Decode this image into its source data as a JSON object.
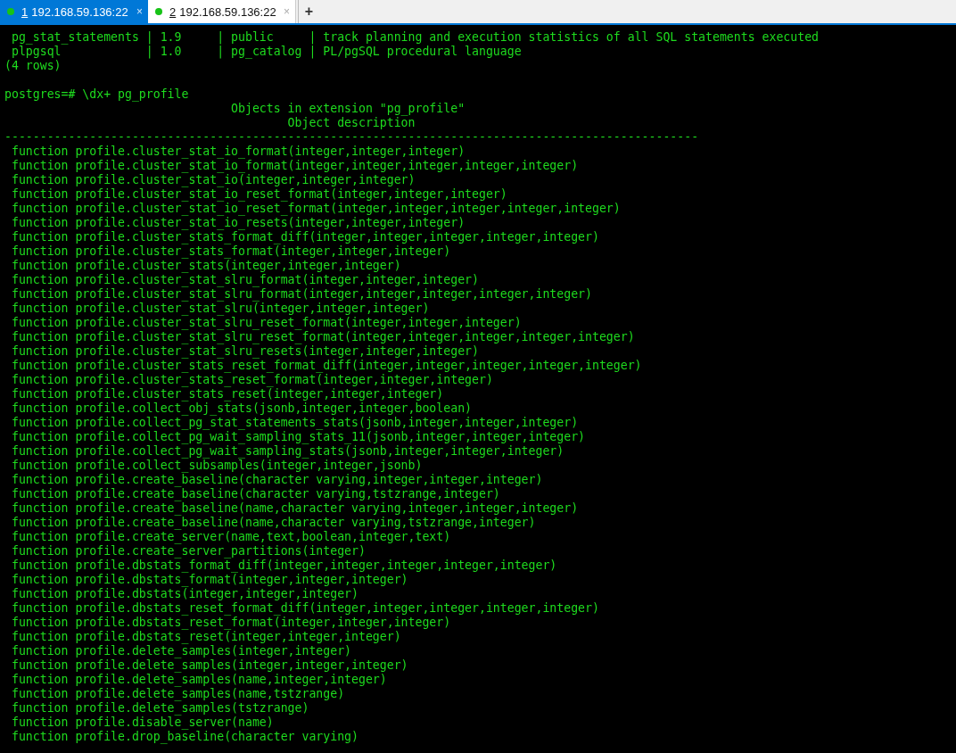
{
  "tabs": [
    {
      "number": "1",
      "address": "192.168.59.136:22",
      "connected": true,
      "selected": true,
      "close": "×"
    },
    {
      "number": "2",
      "address": "192.168.59.136:22",
      "connected": true,
      "selected": false,
      "close": "×"
    }
  ],
  "new_tab": "+",
  "terminal": {
    "blocks": [
      {
        "lines": [
          " pg_stat_statements | 1.9     | public     | track planning and execution statistics of all SQL statements executed",
          " plpgsql            | 1.0     | pg_catalog | PL/pgSQL procedural language",
          "(4 rows)"
        ]
      },
      {
        "lines": [
          "postgres=# \\dx+ pg_profile",
          "                                Objects in extension \"pg_profile\"",
          "                                        Object description",
          "--------------------------------------------------------------------------------------------------",
          " function profile.cluster_stat_io_format(integer,integer,integer)",
          " function profile.cluster_stat_io_format(integer,integer,integer,integer,integer)",
          " function profile.cluster_stat_io(integer,integer,integer)",
          " function profile.cluster_stat_io_reset_format(integer,integer,integer)",
          " function profile.cluster_stat_io_reset_format(integer,integer,integer,integer,integer)",
          " function profile.cluster_stat_io_resets(integer,integer,integer)",
          " function profile.cluster_stats_format_diff(integer,integer,integer,integer,integer)",
          " function profile.cluster_stats_format(integer,integer,integer)",
          " function profile.cluster_stats(integer,integer,integer)",
          " function profile.cluster_stat_slru_format(integer,integer,integer)",
          " function profile.cluster_stat_slru_format(integer,integer,integer,integer,integer)",
          " function profile.cluster_stat_slru(integer,integer,integer)",
          " function profile.cluster_stat_slru_reset_format(integer,integer,integer)",
          " function profile.cluster_stat_slru_reset_format(integer,integer,integer,integer,integer)",
          " function profile.cluster_stat_slru_resets(integer,integer,integer)",
          " function profile.cluster_stats_reset_format_diff(integer,integer,integer,integer,integer)",
          " function profile.cluster_stats_reset_format(integer,integer,integer)",
          " function profile.cluster_stats_reset(integer,integer,integer)",
          " function profile.collect_obj_stats(jsonb,integer,integer,boolean)",
          " function profile.collect_pg_stat_statements_stats(jsonb,integer,integer,integer)",
          " function profile.collect_pg_wait_sampling_stats_11(jsonb,integer,integer,integer)",
          " function profile.collect_pg_wait_sampling_stats(jsonb,integer,integer,integer)",
          " function profile.collect_subsamples(integer,integer,jsonb)",
          " function profile.create_baseline(character varying,integer,integer,integer)",
          " function profile.create_baseline(character varying,tstzrange,integer)",
          " function profile.create_baseline(name,character varying,integer,integer,integer)",
          " function profile.create_baseline(name,character varying,tstzrange,integer)",
          " function profile.create_server(name,text,boolean,integer,text)",
          " function profile.create_server_partitions(integer)",
          " function profile.dbstats_format_diff(integer,integer,integer,integer,integer)",
          " function profile.dbstats_format(integer,integer,integer)",
          " function profile.dbstats(integer,integer,integer)",
          " function profile.dbstats_reset_format_diff(integer,integer,integer,integer,integer)",
          " function profile.dbstats_reset_format(integer,integer,integer)",
          " function profile.dbstats_reset(integer,integer,integer)",
          " function profile.delete_samples(integer,integer)",
          " function profile.delete_samples(integer,integer,integer)",
          " function profile.delete_samples(name,integer,integer)",
          " function profile.delete_samples(name,tstzrange)",
          " function profile.delete_samples(tstzrange)",
          " function profile.disable_server(name)",
          " function profile.drop_baseline(character varying)"
        ]
      }
    ]
  }
}
